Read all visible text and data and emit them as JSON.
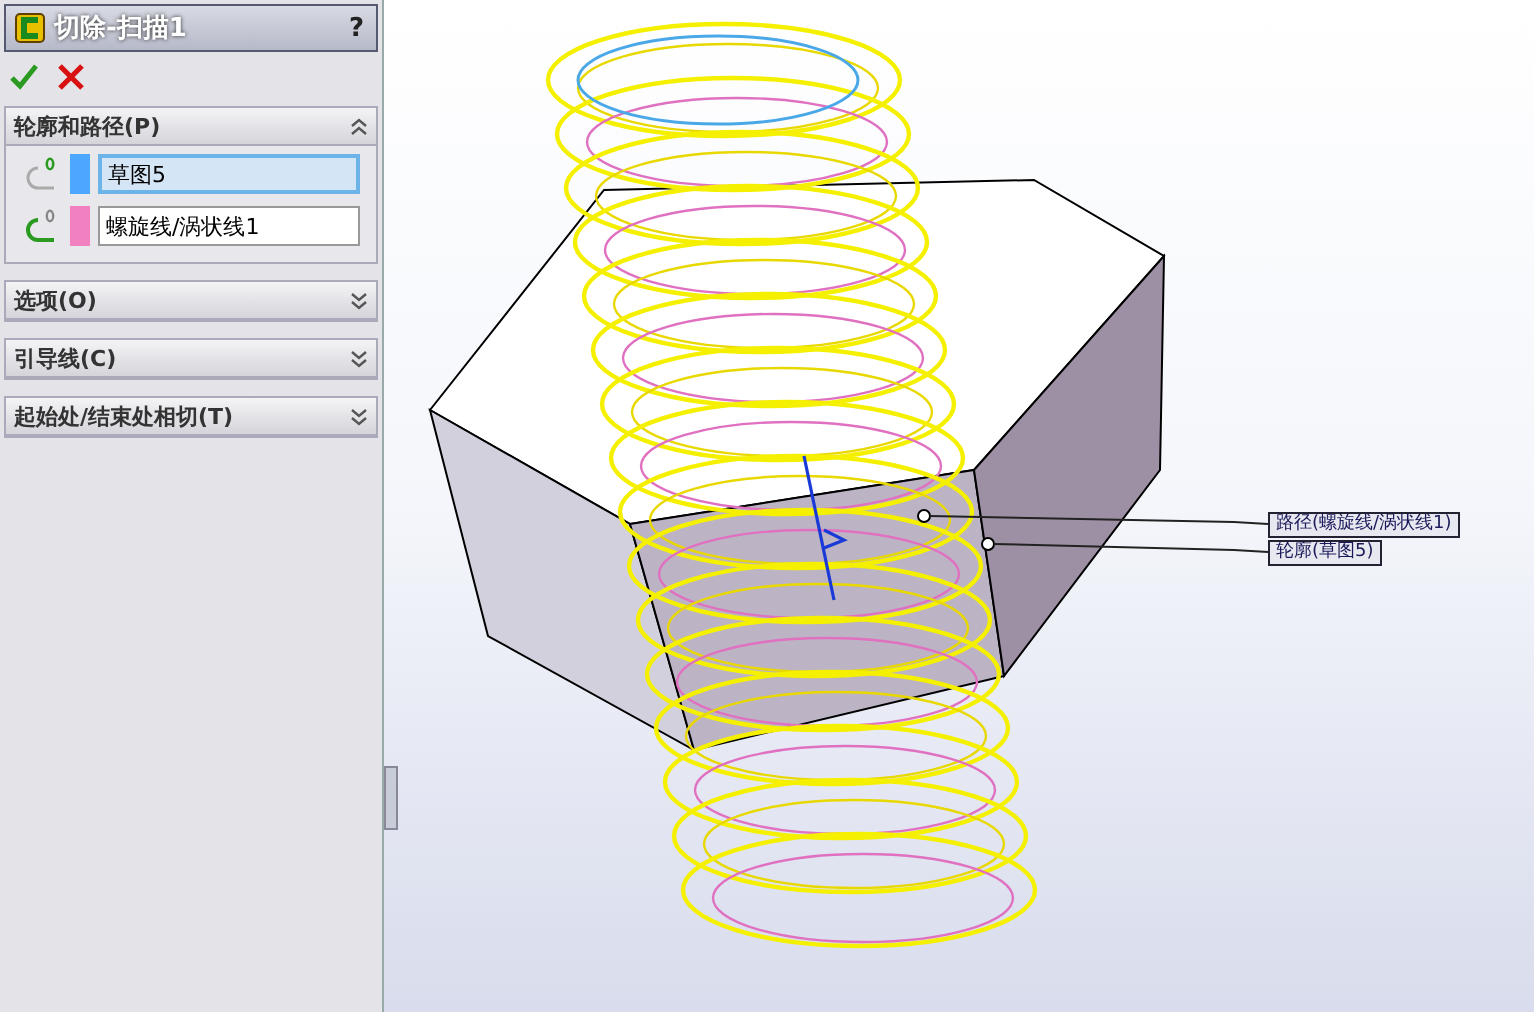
{
  "feature_panel": {
    "title": "切除-扫描1",
    "help": "?"
  },
  "sections": [
    {
      "title": "轮廓和路径(P)",
      "expanded": true,
      "fields": [
        {
          "kind": "profile",
          "value": "草图5",
          "color": "#4da6ff",
          "selected": true
        },
        {
          "kind": "path",
          "value": "螺旋线/涡状线1",
          "color": "#f080c0",
          "selected": false
        }
      ]
    },
    {
      "title": "选项(O)",
      "expanded": false
    },
    {
      "title": "引导线(C)",
      "expanded": false
    },
    {
      "title": "起始处/结束处相切(T)",
      "expanded": false
    }
  ],
  "callouts": [
    {
      "label": "路径(螺旋线/涡状线1)"
    },
    {
      "label": "轮廓(草图5)"
    }
  ]
}
